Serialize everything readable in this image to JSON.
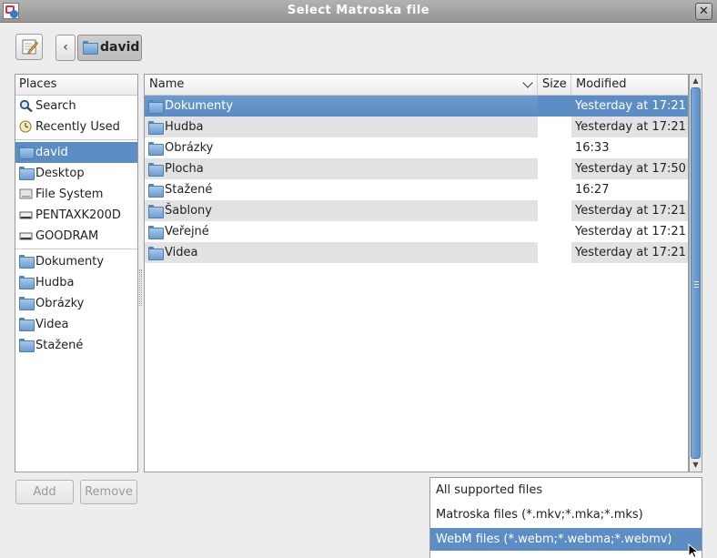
{
  "window": {
    "title": "Select Matroska file"
  },
  "toolbar": {
    "breadcrumb_label": "david"
  },
  "places": {
    "header": "Places",
    "items": [
      {
        "label": "Search",
        "icon": "search-icon"
      },
      {
        "label": "Recently Used",
        "icon": "clock-icon"
      },
      {
        "label": "david",
        "icon": "home-folder-icon",
        "selected": true
      },
      {
        "label": "Desktop",
        "icon": "desktop-folder-icon"
      },
      {
        "label": "File System",
        "icon": "drive-icon"
      },
      {
        "label": "PENTAXK200D",
        "icon": "drive-icon"
      },
      {
        "label": "GOODRAM",
        "icon": "drive-icon"
      },
      {
        "label": "Dokumenty",
        "icon": "folder-icon"
      },
      {
        "label": "Hudba",
        "icon": "folder-icon"
      },
      {
        "label": "Obrázky",
        "icon": "folder-icon"
      },
      {
        "label": "Videa",
        "icon": "folder-icon"
      },
      {
        "label": "Stažené",
        "icon": "folder-icon"
      }
    ]
  },
  "files": {
    "columns": {
      "name": "Name",
      "size": "Size",
      "modified": "Modified"
    },
    "rows": [
      {
        "name": "Dokumenty",
        "size": "",
        "modified": "Yesterday at 17:21"
      },
      {
        "name": "Hudba",
        "size": "",
        "modified": "Yesterday at 17:21"
      },
      {
        "name": "Obrázky",
        "size": "",
        "modified": "16:33"
      },
      {
        "name": "Plocha",
        "size": "",
        "modified": "Yesterday at 17:50"
      },
      {
        "name": "Stažené",
        "size": "",
        "modified": "16:27"
      },
      {
        "name": "Šablony",
        "size": "",
        "modified": "Yesterday at 17:21"
      },
      {
        "name": "Veřejné",
        "size": "",
        "modified": "Yesterday at 17:21"
      },
      {
        "name": "Videa",
        "size": "",
        "modified": "Yesterday at 17:21"
      }
    ]
  },
  "buttons": {
    "add": "Add",
    "remove": "Remove"
  },
  "filter": {
    "options": [
      "All supported files",
      "Matroska files (*.mkv;*.mka;*.mks)",
      "WebM files (*.webm;*.webma;*.webmv)"
    ],
    "selected_index": 2
  },
  "colors": {
    "selection": "#5c8ec5",
    "titlebar": "#a4a4a4"
  }
}
